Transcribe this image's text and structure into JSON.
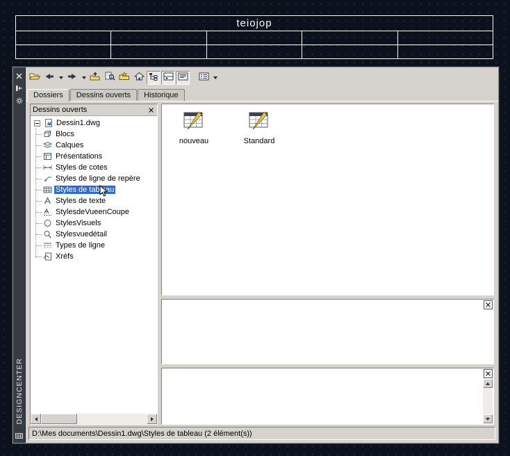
{
  "drawing": {
    "table": {
      "title": "teiojop",
      "columns": 5,
      "body_rows": 2
    }
  },
  "palette": {
    "vertical_title": "DESIGNCENTER",
    "titlebar_icons": [
      "close-icon",
      "autohide-icon",
      "properties-icon"
    ],
    "toolbar": {
      "buttons": [
        {
          "icon": "load-open-folder-icon"
        },
        {
          "icon": "back-arrow-icon",
          "has_dropdown": true
        },
        {
          "icon": "forward-arrow-icon",
          "has_dropdown": true
        },
        {
          "icon": "up-folder-icon"
        },
        {
          "icon": "search-icon"
        },
        {
          "icon": "favorites-icon"
        },
        {
          "icon": "home-icon"
        },
        {
          "icon": "tree-toggle-icon",
          "pressed": true
        },
        {
          "icon": "preview-toggle-icon",
          "pressed": true
        },
        {
          "icon": "description-toggle-icon",
          "pressed": true
        },
        {
          "icon": "views-icon",
          "has_dropdown": true
        }
      ]
    },
    "tabs": [
      {
        "label": "Dossiers",
        "active": true
      },
      {
        "label": "Dessins ouverts",
        "active": false
      },
      {
        "label": "Historique",
        "active": false
      }
    ],
    "tree": {
      "header": "Dessins ouverts",
      "root": {
        "label": "Dessin1.dwg",
        "icon": "dwg-file-icon",
        "expanded": true
      },
      "items": [
        {
          "label": "Blocs",
          "icon": "block-icon"
        },
        {
          "label": "Calques",
          "icon": "layers-icon"
        },
        {
          "label": "Présentations",
          "icon": "layout-icon"
        },
        {
          "label": "Styles de cotes",
          "icon": "dimension-style-icon"
        },
        {
          "label": "Styles de ligne de repère",
          "icon": "leader-style-icon"
        },
        {
          "label": "Styles de tableau",
          "icon": "table-style-icon",
          "selected": true
        },
        {
          "label": "Styles de texte",
          "icon": "text-style-icon"
        },
        {
          "label": "StylesdeVueenCoupe",
          "icon": "section-view-style-icon"
        },
        {
          "label": "StylesVisuels",
          "icon": "visual-style-icon"
        },
        {
          "label": "Stylesvuedétail",
          "icon": "detail-view-style-icon"
        },
        {
          "label": "Types de ligne",
          "icon": "linetype-icon"
        },
        {
          "label": "Xréfs",
          "icon": "xref-icon"
        }
      ]
    },
    "content": {
      "items": [
        {
          "label": "nouveau",
          "icon": "table-style-item-icon"
        },
        {
          "label": "Standard",
          "icon": "table-style-item-icon"
        }
      ]
    },
    "status": "D:\\Mes documents\\Dessin1.dwg\\Styles de tableau (2 élément(s))",
    "colors": {
      "selection": "#2e6bd0",
      "palette_bg": "#d6d3ce",
      "canvas_bg": "#0c121d"
    }
  }
}
